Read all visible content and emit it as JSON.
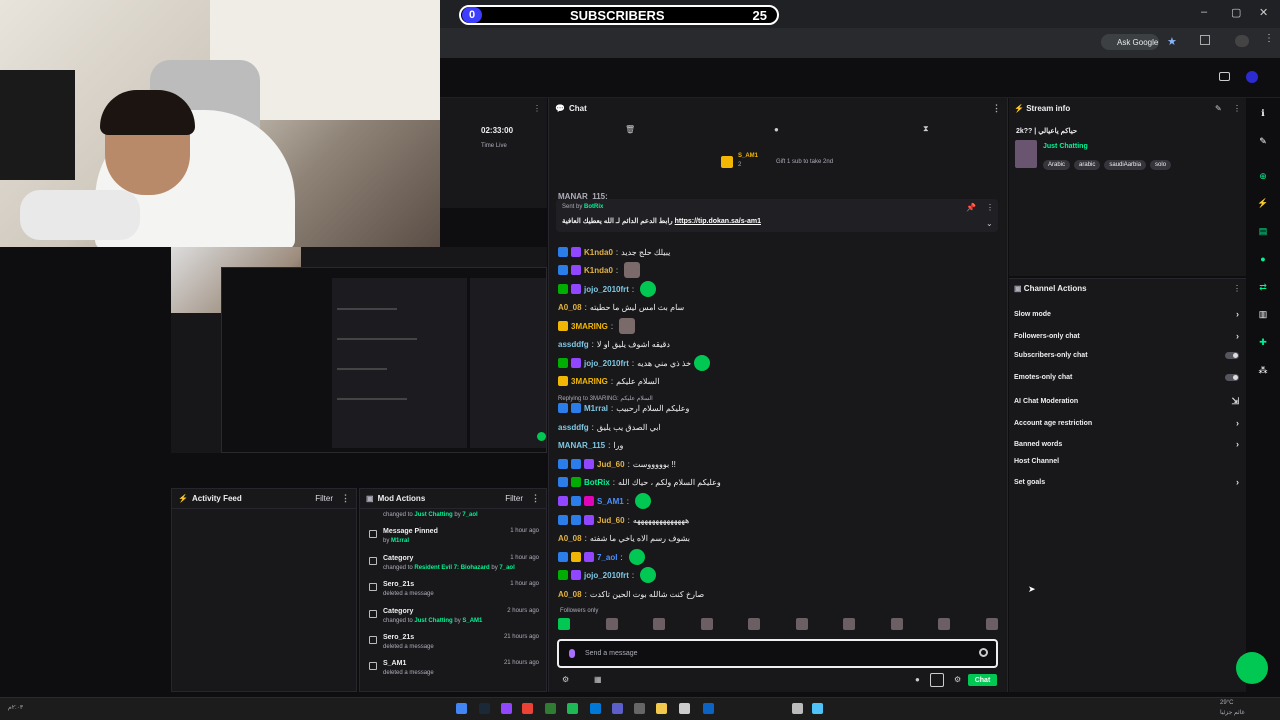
{
  "overlay": {
    "subscribers_label": "SUBSCRIBERS",
    "count_left": "0",
    "count_right": "25"
  },
  "browser": {
    "ask_google": "Ask Google"
  },
  "stats": {
    "uptime": "02:33:00",
    "uptime_label": "Time Live"
  },
  "activity_feed": {
    "title": "Activity Feed",
    "filter": "Filter"
  },
  "mod_actions": {
    "title": "Mod Actions",
    "filter": "Filter",
    "first_line": {
      "prefix": "changed to ",
      "value": "Just Chatting",
      "by": " by ",
      "user": "7_aol"
    },
    "items": [
      {
        "title": "Message Pinned",
        "sub_prefix": "by ",
        "sub_user": "M1rral",
        "sub_value": "",
        "sub_by": "",
        "time": "1 hour ago"
      },
      {
        "title": "Category",
        "sub_prefix": "changed to ",
        "sub_value": "Resident Evil 7: Biohazard",
        "sub_by": " by ",
        "sub_user": "7_aol",
        "time": "1 hour ago"
      },
      {
        "title": "Sero_21s",
        "sub_prefix": "deleted a message",
        "sub_value": "",
        "sub_by": "",
        "sub_user": "",
        "time": "1 hour ago"
      },
      {
        "title": "Category",
        "sub_prefix": "changed to ",
        "sub_value": "Just Chatting",
        "sub_by": " by ",
        "sub_user": "S_AM1",
        "time": "2 hours ago"
      },
      {
        "title": "Sero_21s",
        "sub_prefix": "deleted a message",
        "sub_value": "",
        "sub_by": "",
        "sub_user": "",
        "time": "21 hours ago"
      },
      {
        "title": "S_AM1",
        "sub_prefix": "deleted a message",
        "sub_value": "",
        "sub_by": "",
        "sub_user": "",
        "time": "21 hours ago"
      }
    ]
  },
  "chat": {
    "title": "Chat",
    "gift_user": "S_AM1",
    "gift_count": "2",
    "gift_text": "Gift 1 sub to take 2nd",
    "top_clipped": "MANAR_115:",
    "pinned": {
      "sent_by": "Sent by",
      "user": "BotRix",
      "text_ar": "رابط الدعم الدائم لـ الله يعطيك العافية",
      "link": "https://tip.dokan.sa/s-am1"
    },
    "reply_label": "Replying to 3MARING: السلام عليكم",
    "followers_only": "Followers only",
    "input_placeholder": "Send a message",
    "send_button": "Chat",
    "messages": [
      {
        "user": "K1nda0",
        "color": "#e3b341",
        "text": "يبيلك حلج جديد"
      },
      {
        "user": "K1nda0",
        "color": "#e3b341",
        "text": ""
      },
      {
        "user": "jojo_2010frt",
        "color": "#7ec8e3",
        "text": ""
      },
      {
        "user": "A0_08",
        "color": "#e3b341",
        "text": "سام بث امس ليش ما حطيته"
      },
      {
        "user": "3MARING",
        "color": "#f2b705",
        "text": ""
      },
      {
        "user": "assddfg",
        "color": "#7ec8e3",
        "text": "دقيقه اشوف يليق او لا"
      },
      {
        "user": "jojo_2010frt",
        "color": "#7ec8e3",
        "text": "خذ ذي مني هديه"
      },
      {
        "user": "3MARING",
        "color": "#f2b705",
        "text": "السلام عليكم"
      },
      {
        "user": "M1rral",
        "color": "#7ec8e3",
        "text": "وعليكم السلام ارحبيب"
      },
      {
        "user": "assddfg",
        "color": "#7ec8e3",
        "text": "ابي الصدق يب يليق"
      },
      {
        "user": "MANAR_115",
        "color": "#7ec8e3",
        "text": "ورا"
      },
      {
        "user": "Jud_60",
        "color": "#e3b341",
        "text": "بوووووست !!"
      },
      {
        "user": "BotRix",
        "color": "#00f593",
        "text": "وعليكم السلام ولكم ، حياك الله"
      },
      {
        "user": "S_AM1",
        "color": "#4a90ff",
        "text": ""
      },
      {
        "user": "Jud_60",
        "color": "#e3b341",
        "text": "ههههههههههههههه"
      },
      {
        "user": "A0_08",
        "color": "#e3b341",
        "text": "بشوف رسم الاه ياخي ما شفته"
      },
      {
        "user": "7_aol",
        "color": "#4a90ff",
        "text": ""
      },
      {
        "user": "jojo_2010frt",
        "color": "#7ec8e3",
        "text": ""
      },
      {
        "user": "A0_08",
        "color": "#e3b341",
        "text": "صارخ كنت شالله بوت الحين تاكدت"
      }
    ]
  },
  "stream_info": {
    "title": "Stream info",
    "stream_title": "2k?? | حياكم ياعيالي",
    "category": "Just Chatting",
    "tags": [
      "Arabic",
      "arabic",
      "saudiAarbia",
      "solo"
    ]
  },
  "channel_actions": {
    "title": "Channel Actions",
    "items": [
      {
        "label": "Slow mode",
        "control": "arrow"
      },
      {
        "label": "Followers-only chat",
        "control": "arrow"
      },
      {
        "label": "Subscribers-only chat",
        "control": "toggle"
      },
      {
        "label": "Emotes-only chat",
        "control": "toggle"
      },
      {
        "label": "AI Chat Moderation",
        "control": "ext"
      },
      {
        "label": "Account age restriction",
        "control": "arrow"
      },
      {
        "label": "Banned words",
        "control": "arrow"
      },
      {
        "label": "Host Channel",
        "control": "none"
      },
      {
        "label": "Set goals",
        "control": "arrow"
      }
    ]
  },
  "taskbar": {
    "weather": "29°C",
    "weather_desc": "غائم جزئيا",
    "clock": "٢:٠٣م"
  },
  "colors": {
    "accent": "#00f593",
    "green_button": "#00c853",
    "panel_bg": "#18181b",
    "page_bg": "#0e0e10"
  }
}
